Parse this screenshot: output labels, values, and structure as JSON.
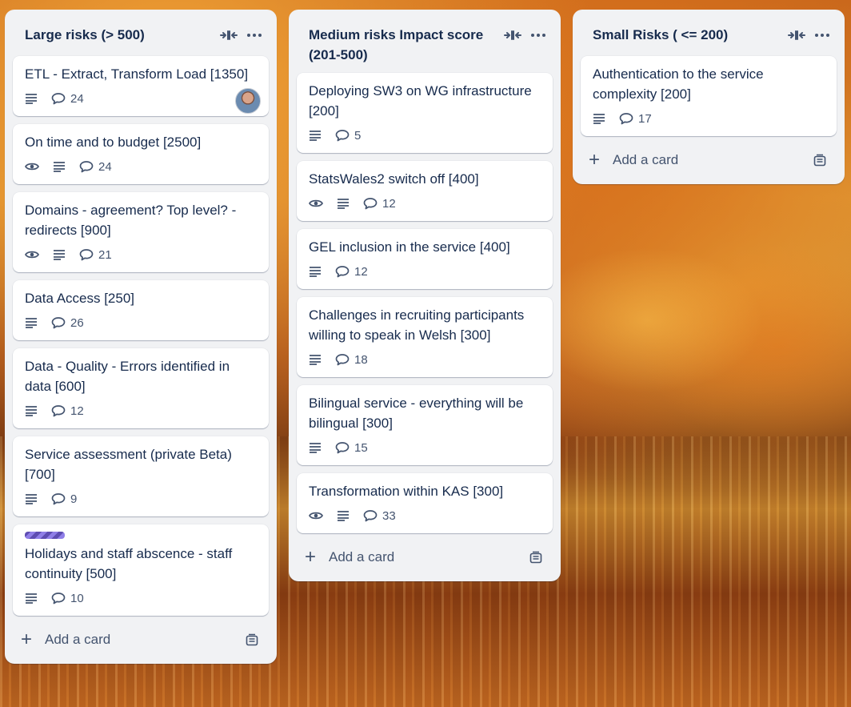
{
  "lists": [
    {
      "title": "Large risks (> 500)",
      "add_card_label": "Add a card",
      "cards": [
        {
          "title": "ETL - Extract, Transform Load [1350]",
          "watch": false,
          "desc": true,
          "comments": "24",
          "avatar": true,
          "label": false
        },
        {
          "title": "On time and to budget [2500]",
          "watch": true,
          "desc": true,
          "comments": "24",
          "avatar": false,
          "label": false
        },
        {
          "title": "Domains - agreement? Top level? - redirects [900]",
          "watch": true,
          "desc": true,
          "comments": "21",
          "avatar": false,
          "label": false
        },
        {
          "title": "Data Access [250]",
          "watch": false,
          "desc": true,
          "comments": "26",
          "avatar": false,
          "label": false
        },
        {
          "title": "Data - Quality - Errors identified in data [600]",
          "watch": false,
          "desc": true,
          "comments": "12",
          "avatar": false,
          "label": false
        },
        {
          "title": "Service assessment (private Beta) [700]",
          "watch": false,
          "desc": true,
          "comments": "9",
          "avatar": false,
          "label": false
        },
        {
          "title": "Holidays and staff abscence - staff continuity [500]",
          "watch": false,
          "desc": true,
          "comments": "10",
          "avatar": false,
          "label": true
        }
      ]
    },
    {
      "title": "Medium risks Impact score (201-500)",
      "add_card_label": "Add a card",
      "cards": [
        {
          "title": "Deploying SW3 on WG infrastructure [200]",
          "watch": false,
          "desc": true,
          "comments": "5",
          "avatar": false,
          "label": false
        },
        {
          "title": "StatsWales2 switch off [400]",
          "watch": true,
          "desc": true,
          "comments": "12",
          "avatar": false,
          "label": false
        },
        {
          "title": "GEL inclusion in the service [400]",
          "watch": false,
          "desc": true,
          "comments": "12",
          "avatar": false,
          "label": false
        },
        {
          "title": "Challenges in recruiting participants willing to speak in Welsh [300]",
          "watch": false,
          "desc": true,
          "comments": "18",
          "avatar": false,
          "label": false
        },
        {
          "title": "Bilingual service - everything will be bilingual [300]",
          "watch": false,
          "desc": true,
          "comments": "15",
          "avatar": false,
          "label": false
        },
        {
          "title": "Transformation within KAS [300]",
          "watch": true,
          "desc": true,
          "comments": "33",
          "avatar": false,
          "label": false
        }
      ]
    },
    {
      "title": "Small Risks ( <= 200)",
      "add_card_label": "Add a card",
      "cards": [
        {
          "title": "Authentication to the service complexity [200]",
          "watch": false,
          "desc": true,
          "comments": "17",
          "avatar": false,
          "label": false
        }
      ]
    }
  ]
}
